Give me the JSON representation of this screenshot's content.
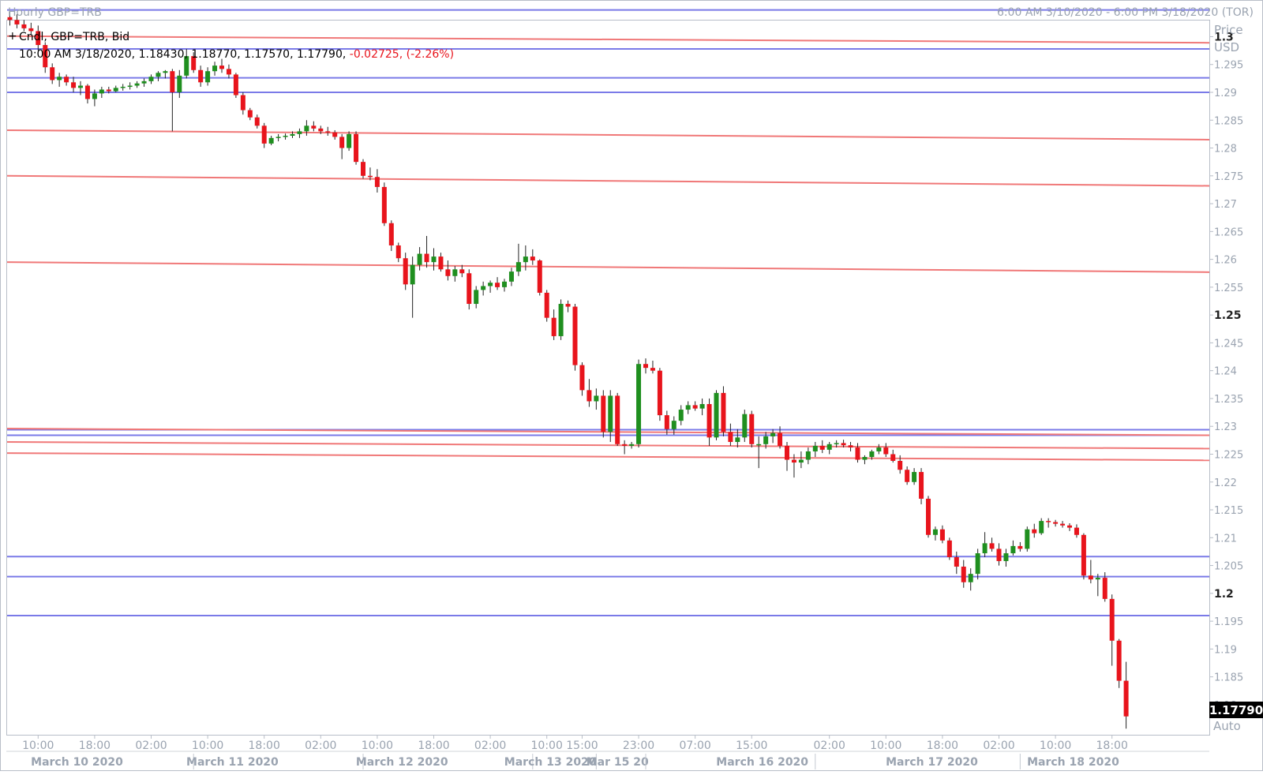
{
  "header": {
    "title": "Hourly GBP=TRB",
    "range": "6:00 AM 3/10/2020 - 6:00 PM 3/18/2020 (TOR)"
  },
  "legend": {
    "line1": "Cndl, GBP=TRB, Bid",
    "ohlc_prefix": "10:00 AM 3/18/2020, 1.18430, 1.18770, 1.17570, 1.17790,",
    "change": "-0.02725, (-2.26%)"
  },
  "price_axis": {
    "title": "Price",
    "unit": "USD",
    "last_price": "1.17790",
    "auto_label": "Auto",
    "ticks": [
      {
        "value": 1.3,
        "label": "1.3",
        "bold": true
      },
      {
        "value": 1.295,
        "label": "1.295"
      },
      {
        "value": 1.29,
        "label": "1.29"
      },
      {
        "value": 1.285,
        "label": "1.285"
      },
      {
        "value": 1.28,
        "label": "1.28"
      },
      {
        "value": 1.275,
        "label": "1.275"
      },
      {
        "value": 1.27,
        "label": "1.27"
      },
      {
        "value": 1.265,
        "label": "1.265"
      },
      {
        "value": 1.26,
        "label": "1.26"
      },
      {
        "value": 1.255,
        "label": "1.255"
      },
      {
        "value": 1.25,
        "label": "1.25",
        "bold": true
      },
      {
        "value": 1.245,
        "label": "1.245"
      },
      {
        "value": 1.24,
        "label": "1.24"
      },
      {
        "value": 1.235,
        "label": "1.235"
      },
      {
        "value": 1.23,
        "label": "1.23"
      },
      {
        "value": 1.225,
        "label": "1.225"
      },
      {
        "value": 1.22,
        "label": "1.22"
      },
      {
        "value": 1.215,
        "label": "1.215"
      },
      {
        "value": 1.21,
        "label": "1.21"
      },
      {
        "value": 1.205,
        "label": "1.205"
      },
      {
        "value": 1.2,
        "label": "1.2",
        "bold": true
      },
      {
        "value": 1.195,
        "label": "1.195"
      },
      {
        "value": 1.19,
        "label": "1.19"
      },
      {
        "value": 1.185,
        "label": "1.185"
      },
      {
        "value": 1.18,
        "label": "1.18"
      }
    ]
  },
  "time_axis": {
    "times": [
      {
        "label": "10:00",
        "index": 4
      },
      {
        "label": "18:00",
        "index": 12
      },
      {
        "label": "02:00",
        "index": 20
      },
      {
        "label": "10:00",
        "index": 28
      },
      {
        "label": "18:00",
        "index": 36
      },
      {
        "label": "02:00",
        "index": 44
      },
      {
        "label": "10:00",
        "index": 52
      },
      {
        "label": "18:00",
        "index": 60
      },
      {
        "label": "02:00",
        "index": 68
      },
      {
        "label": "10:00",
        "index": 76
      },
      {
        "label": "15:00",
        "index": 81
      },
      {
        "label": "23:00",
        "index": 89
      },
      {
        "label": "07:00",
        "index": 97
      },
      {
        "label": "15:00",
        "index": 105
      },
      {
        "label": "02:00",
        "index": 116
      },
      {
        "label": "10:00",
        "index": 124
      },
      {
        "label": "18:00",
        "index": 132
      },
      {
        "label": "02:00",
        "index": 140
      },
      {
        "label": "10:00",
        "index": 148
      },
      {
        "label": "18:00",
        "index": 156
      }
    ],
    "dates": [
      {
        "label": "March 10 2020",
        "index": 9.5,
        "sep": 26
      },
      {
        "label": "March 11 2020",
        "index": 31.5,
        "sep": 50
      },
      {
        "label": "March 12 2020",
        "index": 55.5,
        "sep": 74
      },
      {
        "label": "March 13 2020",
        "index": 76.5,
        "sep": 83
      },
      {
        "label": "Mar 15 20",
        "index": 86,
        "sep": 90
      },
      {
        "label": "March 16 2020",
        "index": 106.5,
        "sep": 114
      },
      {
        "label": "March 17 2020",
        "index": 130.5,
        "sep": 143
      },
      {
        "label": "March 18 2020",
        "index": 150.5,
        "sep": null
      }
    ]
  },
  "colors": {
    "up": "#1f8f1f",
    "down": "#e8141c",
    "support_line": "#7a7ae8",
    "trend_line": "#f07878",
    "grid_text": "#9aa3b0"
  },
  "chart_data": {
    "type": "candlestick",
    "title": "Hourly GBP=TRB",
    "series_name": "GBP=TRB Bid",
    "ylim": [
      1.1746,
      1.3029
    ],
    "ylabel": "Price USD",
    "note": "OHLC bars, hourly, index 0 = 6:00 AM 3/10/2020",
    "ohlc": [
      [
        1.3035,
        1.3045,
        1.302,
        1.303
      ],
      [
        1.303,
        1.304,
        1.3015,
        1.3022
      ],
      [
        1.3022,
        1.303,
        1.301,
        1.3015
      ],
      [
        1.3015,
        1.3025,
        1.3005,
        1.301
      ],
      [
        1.301,
        1.302,
        1.2975,
        1.2985
      ],
      [
        1.2985,
        1.299,
        1.2935,
        1.2945
      ],
      [
        1.2945,
        1.2952,
        1.2915,
        1.2922
      ],
      [
        1.2922,
        1.2935,
        1.291,
        1.2928
      ],
      [
        1.2928,
        1.2932,
        1.2912,
        1.2918
      ],
      [
        1.2918,
        1.2928,
        1.29,
        1.2908
      ],
      [
        1.2908,
        1.292,
        1.2895,
        1.2912
      ],
      [
        1.2912,
        1.2915,
        1.288,
        1.2888
      ],
      [
        1.2888,
        1.2905,
        1.2875,
        1.2898
      ],
      [
        1.2898,
        1.291,
        1.289,
        1.2905
      ],
      [
        1.2905,
        1.291,
        1.2898,
        1.2902
      ],
      [
        1.2902,
        1.2912,
        1.29,
        1.2908
      ],
      [
        1.2908,
        1.2915,
        1.2903,
        1.291
      ],
      [
        1.291,
        1.2918,
        1.2905,
        1.2912
      ],
      [
        1.2912,
        1.292,
        1.2908,
        1.2916
      ],
      [
        1.2916,
        1.2925,
        1.291,
        1.292
      ],
      [
        1.292,
        1.2932,
        1.2915,
        1.2928
      ],
      [
        1.2928,
        1.2938,
        1.292,
        1.2935
      ],
      [
        1.2935,
        1.294,
        1.2925,
        1.2938
      ],
      [
        1.2938,
        1.2942,
        1.283,
        1.29
      ],
      [
        1.29,
        1.294,
        1.289,
        1.293
      ],
      [
        1.293,
        1.2978,
        1.2925,
        1.2965
      ],
      [
        1.2965,
        1.2972,
        1.2935,
        1.294
      ],
      [
        1.294,
        1.2948,
        1.291,
        1.2918
      ],
      [
        1.2918,
        1.2945,
        1.2912,
        1.2938
      ],
      [
        1.2938,
        1.2955,
        1.293,
        1.2948
      ],
      [
        1.2948,
        1.296,
        1.2935,
        1.2942
      ],
      [
        1.2942,
        1.295,
        1.2925,
        1.2932
      ],
      [
        1.2932,
        1.2935,
        1.289,
        1.2895
      ],
      [
        1.2895,
        1.29,
        1.286,
        1.2868
      ],
      [
        1.2868,
        1.2872,
        1.285,
        1.2855
      ],
      [
        1.2855,
        1.286,
        1.2835,
        1.284
      ],
      [
        1.284,
        1.2845,
        1.28,
        1.2808
      ],
      [
        1.2808,
        1.2822,
        1.2805,
        1.2818
      ],
      [
        1.2818,
        1.2825,
        1.2812,
        1.282
      ],
      [
        1.282,
        1.2826,
        1.2815,
        1.2822
      ],
      [
        1.2822,
        1.283,
        1.2818,
        1.2825
      ],
      [
        1.2825,
        1.2835,
        1.2818,
        1.283
      ],
      [
        1.283,
        1.285,
        1.2822,
        1.284
      ],
      [
        1.284,
        1.2848,
        1.283,
        1.2835
      ],
      [
        1.2835,
        1.284,
        1.2825,
        1.283
      ],
      [
        1.283,
        1.2838,
        1.2822,
        1.2828
      ],
      [
        1.2828,
        1.2832,
        1.2815,
        1.282
      ],
      [
        1.282,
        1.2825,
        1.278,
        1.28
      ],
      [
        1.28,
        1.283,
        1.2795,
        1.2825
      ],
      [
        1.2825,
        1.283,
        1.277,
        1.2775
      ],
      [
        1.2775,
        1.278,
        1.2745,
        1.275
      ],
      [
        1.275,
        1.2765,
        1.2742,
        1.2748
      ],
      [
        1.2748,
        1.2762,
        1.272,
        1.273
      ],
      [
        1.273,
        1.2738,
        1.266,
        1.2665
      ],
      [
        1.2665,
        1.267,
        1.2615,
        1.2625
      ],
      [
        1.2625,
        1.263,
        1.2595,
        1.2602
      ],
      [
        1.2602,
        1.2612,
        1.2545,
        1.2555
      ],
      [
        1.2555,
        1.2605,
        1.2495,
        1.259
      ],
      [
        1.259,
        1.2622,
        1.258,
        1.261
      ],
      [
        1.261,
        1.2642,
        1.2585,
        1.2595
      ],
      [
        1.2595,
        1.262,
        1.258,
        1.2605
      ],
      [
        1.2605,
        1.2612,
        1.2578,
        1.2582
      ],
      [
        1.2582,
        1.2598,
        1.2562,
        1.257
      ],
      [
        1.257,
        1.2588,
        1.256,
        1.2582
      ],
      [
        1.2582,
        1.259,
        1.2568,
        1.2575
      ],
      [
        1.2575,
        1.2582,
        1.251,
        1.252
      ],
      [
        1.252,
        1.2552,
        1.2512,
        1.2545
      ],
      [
        1.2545,
        1.256,
        1.2535,
        1.2552
      ],
      [
        1.2552,
        1.2562,
        1.254,
        1.2558
      ],
      [
        1.2558,
        1.2568,
        1.2545,
        1.255
      ],
      [
        1.255,
        1.2565,
        1.2542,
        1.256
      ],
      [
        1.256,
        1.2585,
        1.2552,
        1.2578
      ],
      [
        1.2578,
        1.2628,
        1.257,
        1.2595
      ],
      [
        1.2595,
        1.2625,
        1.258,
        1.2605
      ],
      [
        1.2605,
        1.2618,
        1.259,
        1.2598
      ],
      [
        1.2598,
        1.26,
        1.2535,
        1.254
      ],
      [
        1.254,
        1.2545,
        1.2488,
        1.2495
      ],
      [
        1.2495,
        1.251,
        1.2455,
        1.2462
      ],
      [
        1.2462,
        1.2528,
        1.2455,
        1.252
      ],
      [
        1.252,
        1.2526,
        1.2505,
        1.2515
      ],
      [
        1.2515,
        1.252,
        1.24,
        1.241
      ],
      [
        1.241,
        1.2415,
        1.2355,
        1.2365
      ],
      [
        1.2365,
        1.2385,
        1.2335,
        1.2345
      ],
      [
        1.2345,
        1.2368,
        1.233,
        1.2355
      ],
      [
        1.2355,
        1.2365,
        1.228,
        1.229
      ],
      [
        1.229,
        1.2365,
        1.2272,
        1.2355
      ],
      [
        1.2355,
        1.236,
        1.2265,
        1.2268
      ],
      [
        1.2268,
        1.2275,
        1.225,
        1.2265
      ],
      [
        1.2265,
        1.2272,
        1.226,
        1.2268
      ],
      [
        1.2268,
        1.242,
        1.2262,
        1.2412
      ],
      [
        1.2412,
        1.2422,
        1.2395,
        1.2405
      ],
      [
        1.2405,
        1.2418,
        1.2395,
        1.24
      ],
      [
        1.24,
        1.2405,
        1.231,
        1.232
      ],
      [
        1.232,
        1.2328,
        1.2285,
        1.2295
      ],
      [
        1.2295,
        1.2318,
        1.2285,
        1.231
      ],
      [
        1.231,
        1.2338,
        1.2302,
        1.233
      ],
      [
        1.233,
        1.2345,
        1.2322,
        1.2338
      ],
      [
        1.2338,
        1.2345,
        1.2328,
        1.2332
      ],
      [
        1.2332,
        1.235,
        1.232,
        1.234
      ],
      [
        1.234,
        1.235,
        1.2265,
        1.228
      ],
      [
        1.228,
        1.2365,
        1.2275,
        1.236
      ],
      [
        1.236,
        1.2372,
        1.2282,
        1.229
      ],
      [
        1.229,
        1.2305,
        1.2265,
        1.2272
      ],
      [
        1.2272,
        1.2295,
        1.2262,
        1.228
      ],
      [
        1.228,
        1.233,
        1.2272,
        1.2322
      ],
      [
        1.2322,
        1.2328,
        1.2262,
        1.2268
      ],
      [
        1.2268,
        1.2282,
        1.2225,
        1.2268
      ],
      [
        1.2268,
        1.229,
        1.226,
        1.2282
      ],
      [
        1.2282,
        1.2295,
        1.227,
        1.2288
      ],
      [
        1.2288,
        1.23,
        1.226,
        1.2265
      ],
      [
        1.2265,
        1.2272,
        1.222,
        1.224
      ],
      [
        1.224,
        1.225,
        1.2208,
        1.2235
      ],
      [
        1.2235,
        1.2255,
        1.2225,
        1.224
      ],
      [
        1.224,
        1.2262,
        1.2232,
        1.2255
      ],
      [
        1.2255,
        1.2272,
        1.2245,
        1.2265
      ],
      [
        1.2265,
        1.2275,
        1.2252,
        1.2258
      ],
      [
        1.2258,
        1.2272,
        1.225,
        1.2268
      ],
      [
        1.2268,
        1.2275,
        1.2262,
        1.227
      ],
      [
        1.227,
        1.2276,
        1.2262,
        1.2266
      ],
      [
        1.2266,
        1.2272,
        1.2255,
        1.2262
      ],
      [
        1.2262,
        1.227,
        1.2235,
        1.224
      ],
      [
        1.224,
        1.2248,
        1.2232,
        1.2245
      ],
      [
        1.2245,
        1.2258,
        1.224,
        1.2255
      ],
      [
        1.2255,
        1.2268,
        1.225,
        1.2262
      ],
      [
        1.2262,
        1.227,
        1.2245,
        1.225
      ],
      [
        1.225,
        1.2258,
        1.2235,
        1.2238
      ],
      [
        1.2238,
        1.2248,
        1.2215,
        1.2222
      ],
      [
        1.2222,
        1.2228,
        1.2195,
        1.22
      ],
      [
        1.22,
        1.2225,
        1.2195,
        1.2218
      ],
      [
        1.2218,
        1.2225,
        1.216,
        1.217
      ],
      [
        1.217,
        1.2175,
        1.21,
        1.2105
      ],
      [
        1.2105,
        1.212,
        1.2095,
        1.2115
      ],
      [
        1.2115,
        1.2122,
        1.209,
        1.2095
      ],
      [
        1.2095,
        1.21,
        1.206,
        1.2065
      ],
      [
        1.2065,
        1.2075,
        1.2035,
        1.2048
      ],
      [
        1.2048,
        1.206,
        1.201,
        1.202
      ],
      [
        1.202,
        1.2045,
        1.2005,
        1.2035
      ],
      [
        1.2035,
        1.208,
        1.2025,
        1.2072
      ],
      [
        1.2072,
        1.211,
        1.2065,
        1.209
      ],
      [
        1.209,
        1.21,
        1.2075,
        1.208
      ],
      [
        1.208,
        1.209,
        1.205,
        1.2058
      ],
      [
        1.2058,
        1.208,
        1.2048,
        1.2072
      ],
      [
        1.2072,
        1.2095,
        1.2068,
        1.2085
      ],
      [
        1.2085,
        1.2092,
        1.2075,
        1.208
      ],
      [
        1.208,
        1.212,
        1.2075,
        1.2115
      ],
      [
        1.2115,
        1.2125,
        1.21,
        1.2108
      ],
      [
        1.2108,
        1.2135,
        1.2105,
        1.213
      ],
      [
        1.213,
        1.2135,
        1.2118,
        1.2128
      ],
      [
        1.2128,
        1.2132,
        1.212,
        1.2125
      ],
      [
        1.2125,
        1.213,
        1.2118,
        1.2122
      ],
      [
        1.2122,
        1.2126,
        1.2112,
        1.2118
      ],
      [
        1.2118,
        1.2124,
        1.21,
        1.2105
      ],
      [
        1.2105,
        1.2108,
        1.2025,
        1.2032
      ],
      [
        1.2032,
        1.206,
        1.2018,
        1.2025
      ],
      [
        1.2025,
        1.2035,
        1.1995,
        1.2028
      ],
      [
        1.2028,
        1.2038,
        1.1985,
        1.199
      ],
      [
        1.199,
        1.1998,
        1.187,
        1.1915
      ],
      [
        1.1915,
        1.1918,
        1.183,
        1.1843
      ],
      [
        1.1843,
        1.1877,
        1.1757,
        1.1779
      ]
    ]
  },
  "overlay_lines": {
    "horizontal": [
      1.3048,
      1.2978,
      1.2926,
      1.29,
      1.2294,
      1.2284,
      1.2066,
      1.203,
      1.196
    ],
    "trend": [
      [
        1.3001,
        1.2989
      ],
      [
        1.2832,
        1.2815
      ],
      [
        1.275,
        1.2732
      ],
      [
        1.2595,
        1.2577
      ],
      [
        1.2296,
        1.2284
      ],
      [
        1.2272,
        1.226
      ],
      [
        1.2252,
        1.2239
      ]
    ]
  }
}
